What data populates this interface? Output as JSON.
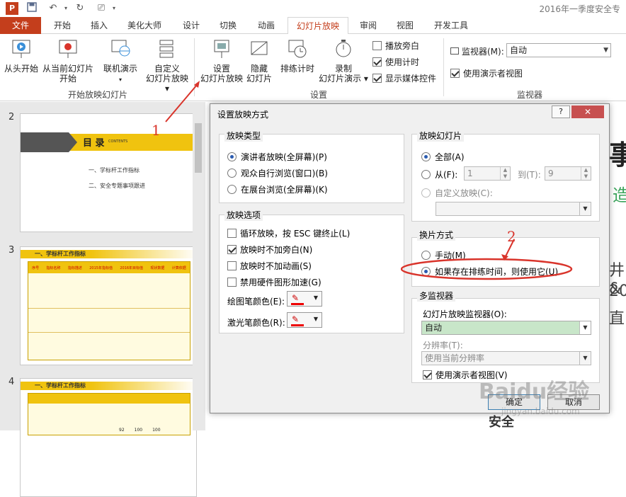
{
  "app": {
    "doc_title": "2016年一季度安全专",
    "qa_icons": [
      "powerpoint-icon",
      "save-icon",
      "undo-icon",
      "redo-icon",
      "present-icon"
    ]
  },
  "tabs": {
    "file": "文件",
    "home": "开始",
    "insert": "插入",
    "beautify": "美化大师",
    "design": "设计",
    "transitions": "切换",
    "animations": "动画",
    "slideshow": "幻灯片放映",
    "review": "审阅",
    "view": "视图",
    "developer": "开发工具"
  },
  "ribbon": {
    "from_start": "从头开始",
    "from_current_1": "从当前幻灯片",
    "from_current_2": "开始",
    "online_1": "联机演示",
    "custom_1": "自定义",
    "custom_2": "幻灯片放映",
    "group_start": "开始放映幻灯片",
    "setup_1": "设置",
    "setup_2": "幻灯片放映",
    "hide_1": "隐藏",
    "hide_2": "幻灯片",
    "rehearse": "排练计时",
    "record_1": "录制",
    "record_2": "幻灯片演示",
    "chk_narration": "播放旁白",
    "chk_timings": "使用计时",
    "chk_media": "显示媒体控件",
    "group_setup": "设置",
    "monitor_label": "监视器(M):",
    "monitor_value": "自动",
    "chk_presenter": "使用演示者视图",
    "group_monitor": "监视器"
  },
  "slides": {
    "n2": "2",
    "n3": "3",
    "n4": "4",
    "s2_title": "目 录",
    "s2_contents": "CONTENTS",
    "s2_item1": "一、学标杆工作指标",
    "s2_item2": "二、安全专题事项跟进",
    "s3_title": "一、学标杆工作指标",
    "s3_headers": [
      "序号",
      "指标名称",
      "指标描述",
      "2015年指标值",
      "2016年目标值",
      "现状数据",
      "计算依据"
    ],
    "s4_title": "一、学标杆工作指标",
    "s4_nums": [
      "92",
      "100",
      "100"
    ]
  },
  "dialog": {
    "title": "设置放映方式",
    "help": "?",
    "close": "✕",
    "show_type_label": "放映类型",
    "type_presenter": "演讲者放映(全屏幕)(P)",
    "type_browse_window": "观众自行浏览(窗口)(B)",
    "type_kiosk": "在展台浏览(全屏幕)(K)",
    "options_label": "放映选项",
    "opt_loop": "循环放映，按 ESC 键终止(L)",
    "opt_no_narration": "放映时不加旁白(N)",
    "opt_no_animation": "放映时不加动画(S)",
    "opt_no_hw": "禁用硬件图形加速(G)",
    "pen_color": "绘图笔颜色(E):",
    "laser_color": "激光笔颜色(R):",
    "slides_label": "放映幻灯片",
    "slides_all": "全部(A)",
    "slides_from": "从(F):",
    "slides_from_val": "1",
    "slides_to": "到(T):",
    "slides_to_val": "9",
    "slides_custom": "自定义放映(C):",
    "advance_label": "换片方式",
    "advance_manual": "手动(M)",
    "advance_timings": "如果存在排练时间，则使用它(U)",
    "multimon_label": "多监视器",
    "monitor_label": "幻灯片放映监视器(O):",
    "monitor_value": "自动",
    "resolution_label": "分辨率(T):",
    "resolution_value": "使用当前分辨率",
    "presenter_view": "使用演示者视图(V)",
    "ok": "确定",
    "cancel": "取消"
  },
  "annotations": {
    "num1": "1",
    "num2": "2",
    "color": "#d9342b"
  },
  "right_slide": {
    "c1": "事",
    "c2": "造",
    "c3": "井&",
    "c4": "20",
    "c5": "直:",
    "c6": "安全"
  },
  "watermark": {
    "brand": "Baidu经验",
    "url": "jingyan.baidu.com"
  }
}
